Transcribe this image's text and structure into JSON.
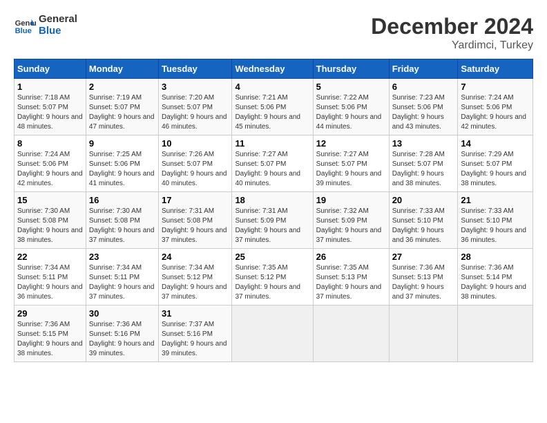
{
  "header": {
    "logo_general": "General",
    "logo_blue": "Blue",
    "title": "December 2024",
    "subtitle": "Yardimci, Turkey"
  },
  "weekdays": [
    "Sunday",
    "Monday",
    "Tuesday",
    "Wednesday",
    "Thursday",
    "Friday",
    "Saturday"
  ],
  "weeks": [
    [
      {
        "day": "1",
        "sunrise": "7:18 AM",
        "sunset": "5:07 PM",
        "daylight": "9 hours and 48 minutes."
      },
      {
        "day": "2",
        "sunrise": "7:19 AM",
        "sunset": "5:07 PM",
        "daylight": "9 hours and 47 minutes."
      },
      {
        "day": "3",
        "sunrise": "7:20 AM",
        "sunset": "5:07 PM",
        "daylight": "9 hours and 46 minutes."
      },
      {
        "day": "4",
        "sunrise": "7:21 AM",
        "sunset": "5:06 PM",
        "daylight": "9 hours and 45 minutes."
      },
      {
        "day": "5",
        "sunrise": "7:22 AM",
        "sunset": "5:06 PM",
        "daylight": "9 hours and 44 minutes."
      },
      {
        "day": "6",
        "sunrise": "7:23 AM",
        "sunset": "5:06 PM",
        "daylight": "9 hours and 43 minutes."
      },
      {
        "day": "7",
        "sunrise": "7:24 AM",
        "sunset": "5:06 PM",
        "daylight": "9 hours and 42 minutes."
      }
    ],
    [
      {
        "day": "8",
        "sunrise": "7:24 AM",
        "sunset": "5:06 PM",
        "daylight": "9 hours and 42 minutes."
      },
      {
        "day": "9",
        "sunrise": "7:25 AM",
        "sunset": "5:06 PM",
        "daylight": "9 hours and 41 minutes."
      },
      {
        "day": "10",
        "sunrise": "7:26 AM",
        "sunset": "5:07 PM",
        "daylight": "9 hours and 40 minutes."
      },
      {
        "day": "11",
        "sunrise": "7:27 AM",
        "sunset": "5:07 PM",
        "daylight": "9 hours and 40 minutes."
      },
      {
        "day": "12",
        "sunrise": "7:27 AM",
        "sunset": "5:07 PM",
        "daylight": "9 hours and 39 minutes."
      },
      {
        "day": "13",
        "sunrise": "7:28 AM",
        "sunset": "5:07 PM",
        "daylight": "9 hours and 38 minutes."
      },
      {
        "day": "14",
        "sunrise": "7:29 AM",
        "sunset": "5:07 PM",
        "daylight": "9 hours and 38 minutes."
      }
    ],
    [
      {
        "day": "15",
        "sunrise": "7:30 AM",
        "sunset": "5:08 PM",
        "daylight": "9 hours and 38 minutes."
      },
      {
        "day": "16",
        "sunrise": "7:30 AM",
        "sunset": "5:08 PM",
        "daylight": "9 hours and 37 minutes."
      },
      {
        "day": "17",
        "sunrise": "7:31 AM",
        "sunset": "5:08 PM",
        "daylight": "9 hours and 37 minutes."
      },
      {
        "day": "18",
        "sunrise": "7:31 AM",
        "sunset": "5:09 PM",
        "daylight": "9 hours and 37 minutes."
      },
      {
        "day": "19",
        "sunrise": "7:32 AM",
        "sunset": "5:09 PM",
        "daylight": "9 hours and 37 minutes."
      },
      {
        "day": "20",
        "sunrise": "7:33 AM",
        "sunset": "5:10 PM",
        "daylight": "9 hours and 36 minutes."
      },
      {
        "day": "21",
        "sunrise": "7:33 AM",
        "sunset": "5:10 PM",
        "daylight": "9 hours and 36 minutes."
      }
    ],
    [
      {
        "day": "22",
        "sunrise": "7:34 AM",
        "sunset": "5:11 PM",
        "daylight": "9 hours and 36 minutes."
      },
      {
        "day": "23",
        "sunrise": "7:34 AM",
        "sunset": "5:11 PM",
        "daylight": "9 hours and 37 minutes."
      },
      {
        "day": "24",
        "sunrise": "7:34 AM",
        "sunset": "5:12 PM",
        "daylight": "9 hours and 37 minutes."
      },
      {
        "day": "25",
        "sunrise": "7:35 AM",
        "sunset": "5:12 PM",
        "daylight": "9 hours and 37 minutes."
      },
      {
        "day": "26",
        "sunrise": "7:35 AM",
        "sunset": "5:13 PM",
        "daylight": "9 hours and 37 minutes."
      },
      {
        "day": "27",
        "sunrise": "7:36 AM",
        "sunset": "5:13 PM",
        "daylight": "9 hours and 37 minutes."
      },
      {
        "day": "28",
        "sunrise": "7:36 AM",
        "sunset": "5:14 PM",
        "daylight": "9 hours and 38 minutes."
      }
    ],
    [
      {
        "day": "29",
        "sunrise": "7:36 AM",
        "sunset": "5:15 PM",
        "daylight": "9 hours and 38 minutes."
      },
      {
        "day": "30",
        "sunrise": "7:36 AM",
        "sunset": "5:16 PM",
        "daylight": "9 hours and 39 minutes."
      },
      {
        "day": "31",
        "sunrise": "7:37 AM",
        "sunset": "5:16 PM",
        "daylight": "9 hours and 39 minutes."
      },
      null,
      null,
      null,
      null
    ]
  ]
}
